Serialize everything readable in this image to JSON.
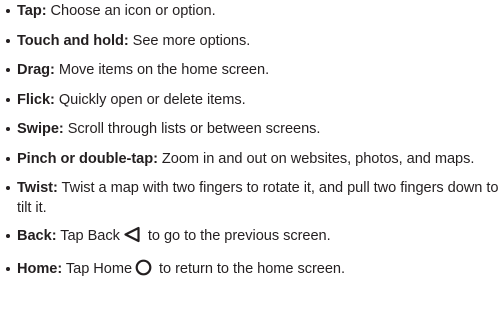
{
  "gestures": [
    {
      "term": "Tap:",
      "desc": " Choose an icon or option."
    },
    {
      "term": "Touch and hold:",
      "desc": " See more options."
    },
    {
      "term": "Drag:",
      "desc": " Move items on the home screen."
    },
    {
      "term": "Flick:",
      "desc": " Quickly open or delete items."
    },
    {
      "term": "Swipe:",
      "desc": " Scroll through lists or between screens."
    },
    {
      "term": "Pinch or double-tap:",
      "desc": " Zoom in and out on websites, photos, and maps."
    },
    {
      "term": "Twist:",
      "desc": " Twist a map with two fingers to rotate it, and pull two fingers down to tilt it."
    },
    {
      "term": "Back:",
      "desc": " Tap Back",
      "icon": "back-triangle-icon",
      "desc_after": " to go to the previous screen."
    },
    {
      "term": "Home:",
      "desc": " Tap Home",
      "icon": "home-circle-icon",
      "desc_after": " to return to the home screen."
    }
  ]
}
